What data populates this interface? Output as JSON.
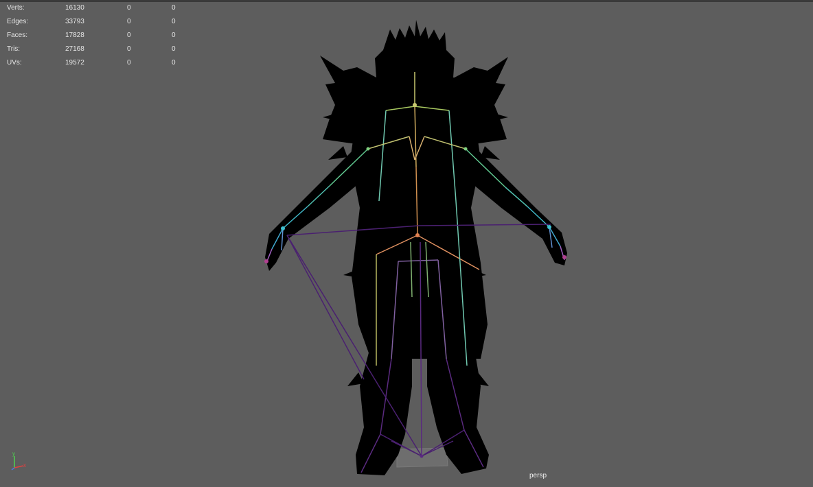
{
  "hud": {
    "rows": [
      {
        "label": "Verts:",
        "v1": "16130",
        "v2": "0",
        "v3": "0"
      },
      {
        "label": "Edges:",
        "v1": "33793",
        "v2": "0",
        "v3": "0"
      },
      {
        "label": "Faces:",
        "v1": "17828",
        "v2": "0",
        "v3": "0"
      },
      {
        "label": "Tris:",
        "v1": "27168",
        "v2": "0",
        "v3": "0"
      },
      {
        "label": "UVs:",
        "v1": "19572",
        "v2": "0",
        "v3": "0"
      }
    ]
  },
  "viewport": {
    "camera": "persp",
    "background": "#5d5d5d",
    "silhouette_color": "#000000"
  },
  "axis_indicator": {
    "y_label": "y",
    "x_label": "x",
    "y_color": "#4fd24f",
    "x_color": "#e04040",
    "z_color": "#4a78e0"
  },
  "icons": {
    "axis": "view-axis-icon",
    "character": "character-model-icon",
    "skeleton": "skeleton-joints-icon"
  }
}
